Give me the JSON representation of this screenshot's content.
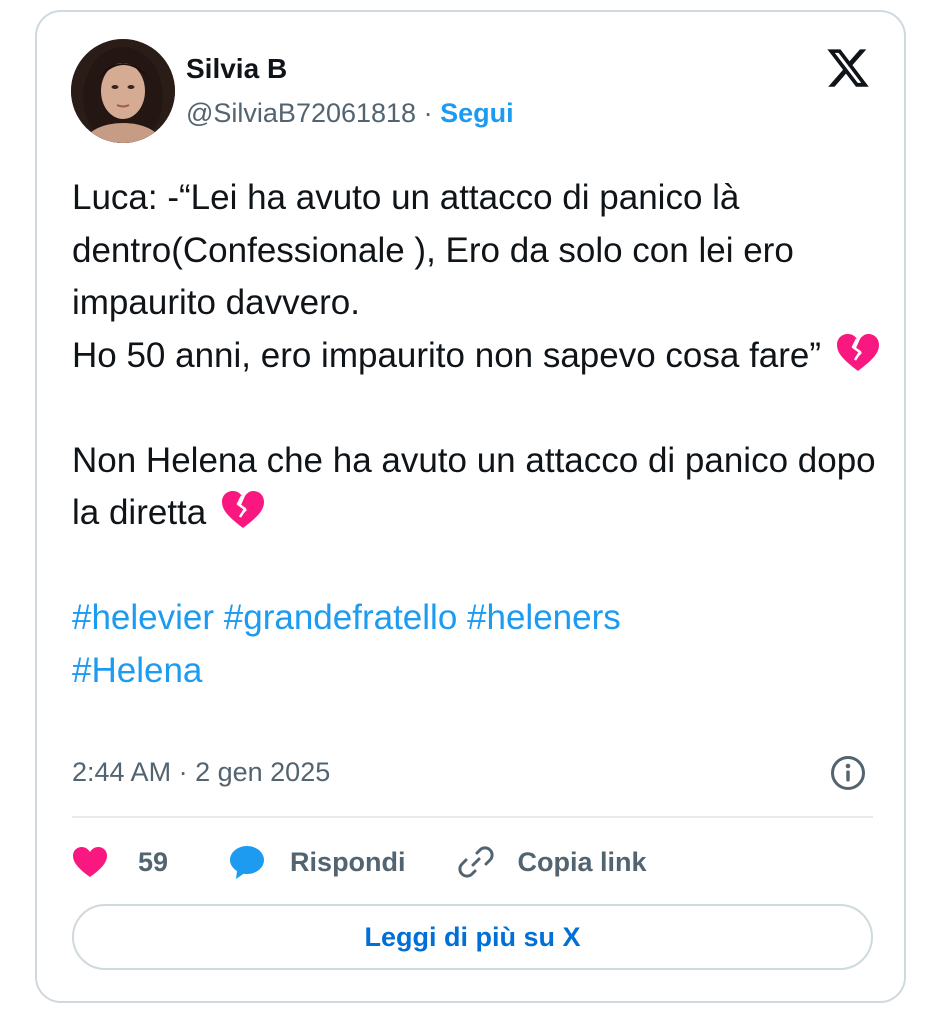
{
  "author": {
    "name": "Silvia B",
    "handle": "@SilviaB72061818",
    "separator": "·",
    "follow_label": "Segui"
  },
  "brand": {
    "logo_icon": "x-logo-icon"
  },
  "tweet": {
    "lines": {
      "p1": "Luca: -“Lei ha avuto un attacco di panico là dentro(Confessionale ), Ero da solo con lei ero impaurito davvero.",
      "p2": "Ho 50 anni, ero impaurito non sapevo cosa fare”",
      "p3": "Non Helena che ha avuto un attacco di panico dopo la diretta"
    },
    "emoji": "broken-heart-icon",
    "hashtags": [
      "#helevier",
      "#grandefratello",
      "#heleners",
      "#Helena"
    ]
  },
  "meta": {
    "time": "2:44 AM",
    "separator": "·",
    "date": "2 gen 2025"
  },
  "actions": {
    "likes_count": "59",
    "reply_label": "Rispondi",
    "copy_label": "Copia link"
  },
  "footer": {
    "read_more_label": "Leggi di più su X"
  },
  "colors": {
    "accent": "#1d9bf0",
    "heart": "#f91880",
    "muted": "#536471",
    "text": "#0f1419",
    "border": "#cfd9de"
  }
}
